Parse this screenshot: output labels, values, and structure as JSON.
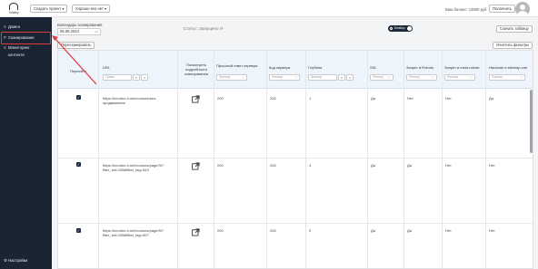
{
  "topbar": {
    "logo_text": "Тotsitey",
    "create_project": "Создать проект",
    "good_seo": "Хорошо seo нет",
    "balance": "Ваш баланс: 13500 руб",
    "topup": "Пополнить"
  },
  "sidebar": {
    "items": [
      {
        "icon": "≡",
        "label": "Домен"
      },
      {
        "icon": "P",
        "label": "Сканирование"
      },
      {
        "icon": "≡",
        "label": "Мониторинг"
      },
      {
        "icon": "",
        "label": "контента"
      }
    ],
    "settings": "Настройки"
  },
  "controls": {
    "date_label": "Календарь сканирования",
    "date_value": "05.06.2024",
    "status": "Статус: Запущено ⟳",
    "toggle_label": "Desktop",
    "download_btn": "Скачать таблицу",
    "rescan_btn": "Пересканировать",
    "clear_filters_btn": "Очистить фильтры"
  },
  "table": {
    "headers": {
      "rescan": "Пересйти",
      "url": "URL",
      "confirm": "Посмотреть подробности сканирования",
      "prev_response": "Прошлый ответ сервера",
      "code": "Код сервера",
      "depth": "Глубина",
      "ssl": "SSL",
      "robots_disallow": "Запрет в Robots",
      "meta_robots": "Запрет в meta robots",
      "sitemap": "Наличие в sitemap.xml"
    },
    "filter_placeholder": "Фильтр",
    "url_placeholder": "Поиск",
    "rows": [
      {
        "url": "https://tonotno-ir.net/courses/seo-продвижение",
        "prev": "200",
        "code": "200",
        "depth": "1",
        "ssl": "Да",
        "robots": "Нет",
        "meta": "Нет",
        "sitemap": "Да"
      },
      {
        "url": "https://tonotno-ir.net/courses/page/3/?filter_set=2658filter_tag=343",
        "prev": "200",
        "code": "200",
        "depth": "4",
        "ssl": "Да",
        "robots": "Да",
        "meta": "Нет",
        "sitemap": "Нет"
      },
      {
        "url": "https://tonotno-ir.net/courses/page/5/?filter_set=2658filter_tag=307",
        "prev": "200",
        "code": "200",
        "depth": "5",
        "ssl": "Да",
        "robots": "Да",
        "meta": "Нет",
        "sitemap": "Нет"
      }
    ]
  },
  "colors": {
    "accent": "#1e2a3c",
    "highlight": "#e23b3b"
  }
}
